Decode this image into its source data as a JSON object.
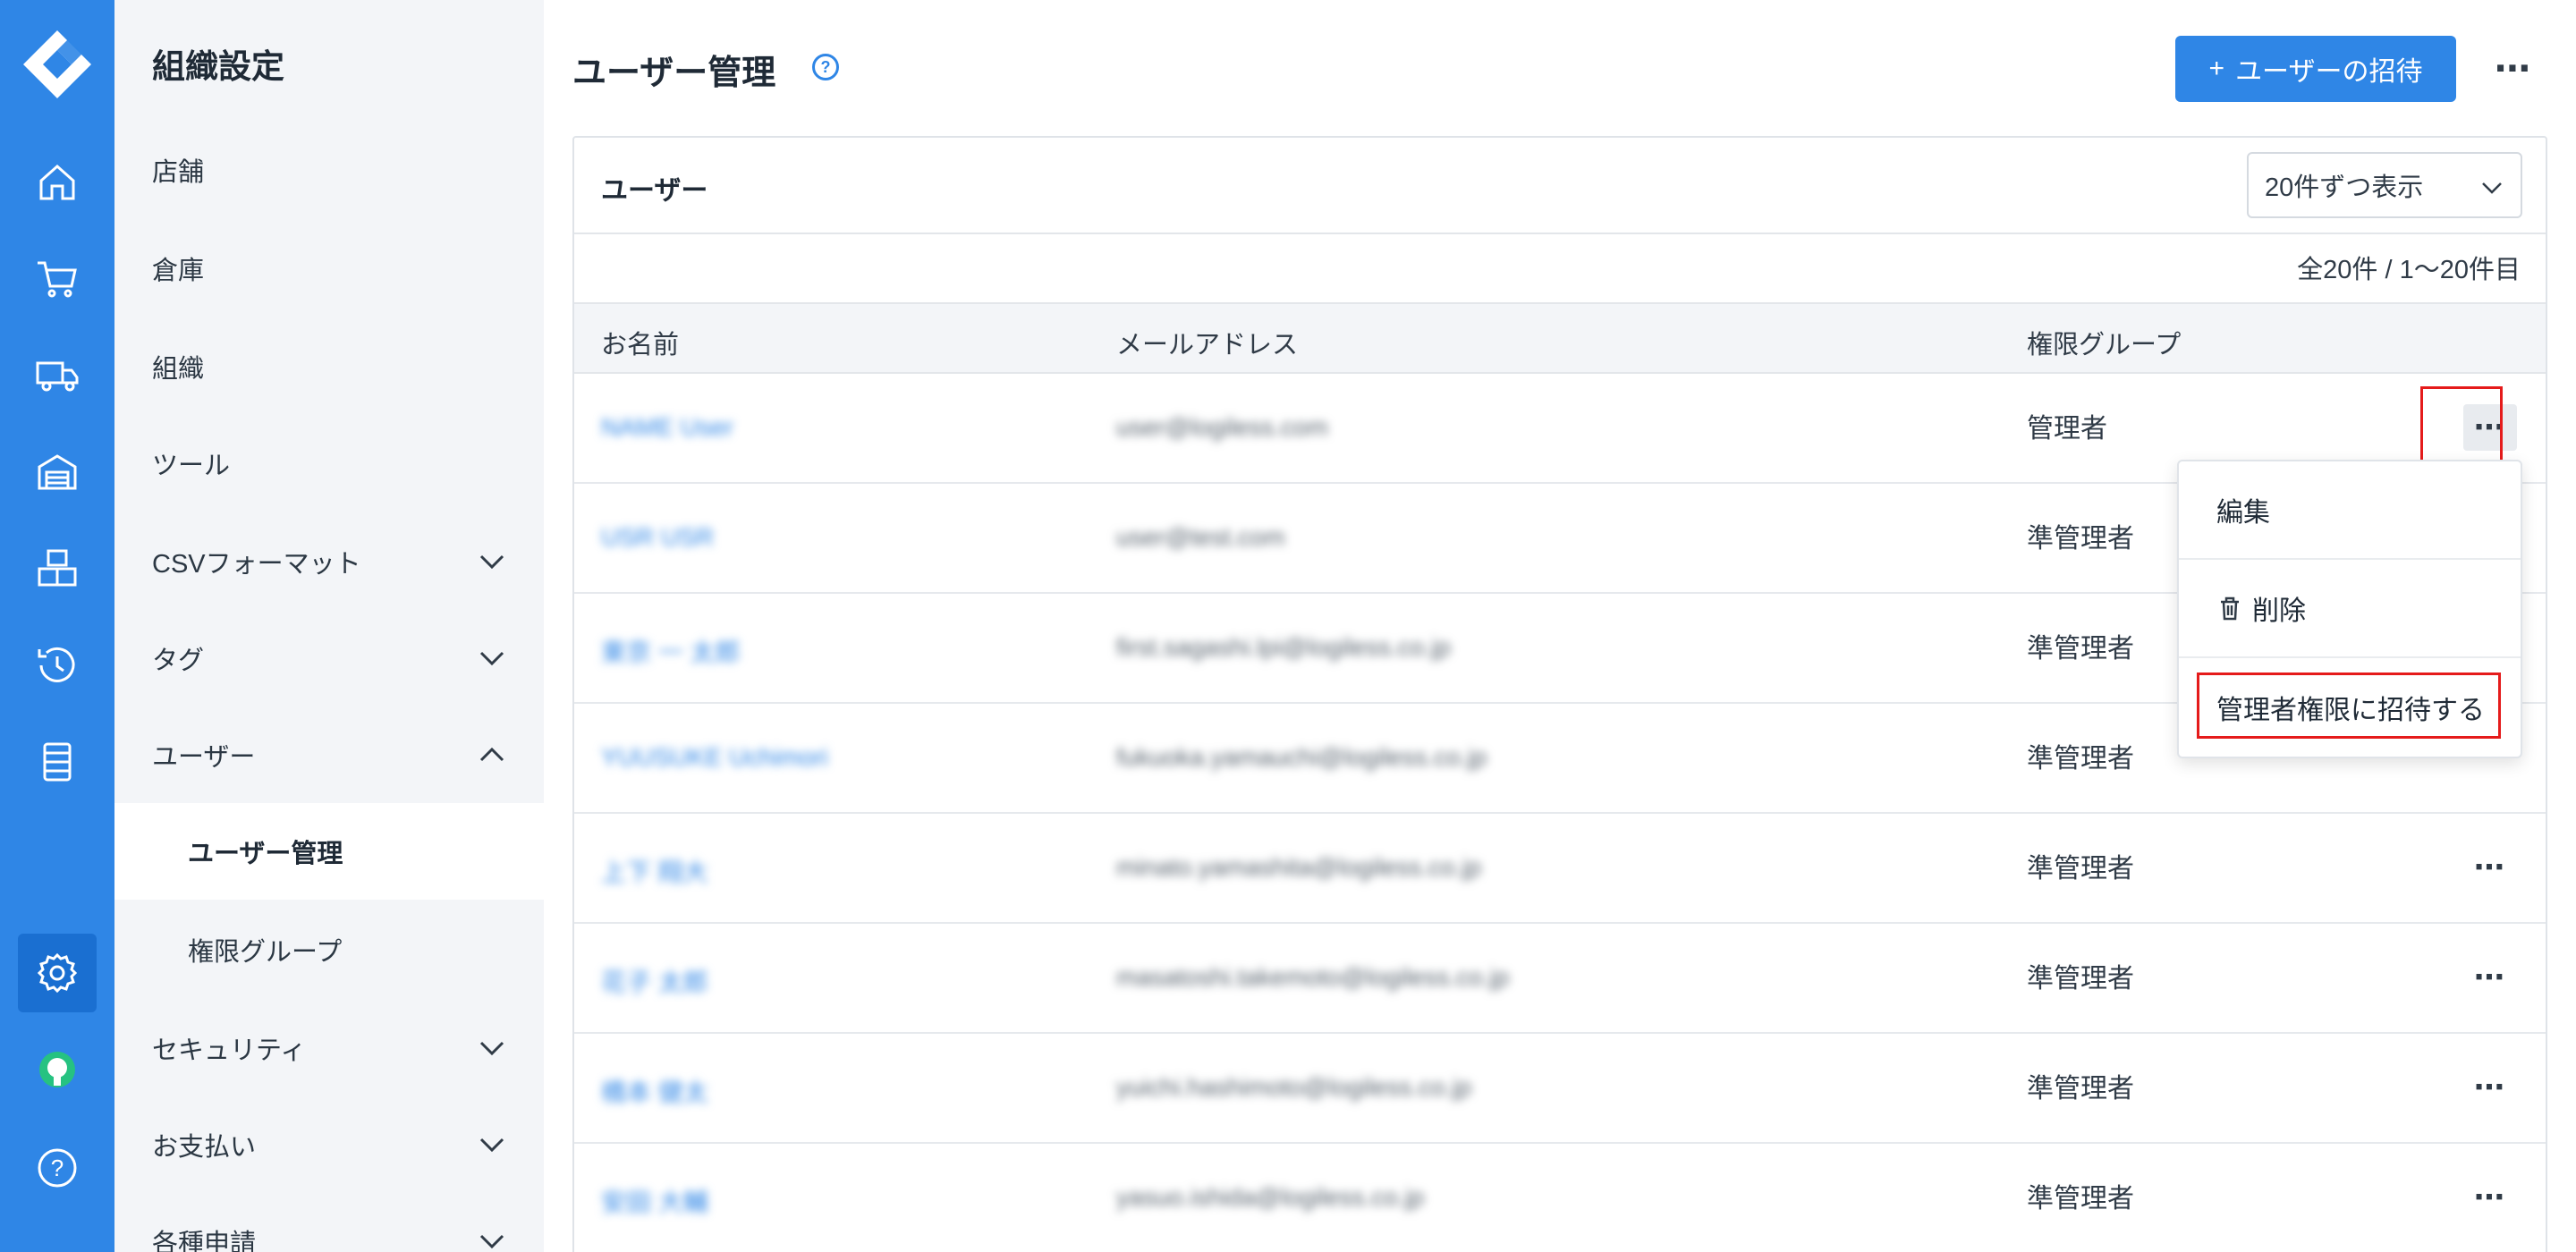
{
  "rail": {
    "icons": [
      "home-icon",
      "cart-icon",
      "truck-icon",
      "warehouse-icon",
      "boxes-icon",
      "history-icon",
      "list-icon",
      "gear-icon",
      "bulb-icon",
      "help-icon"
    ],
    "help_glyph": "?"
  },
  "sidebar": {
    "title": "組織設定",
    "items": [
      {
        "label": "店舗"
      },
      {
        "label": "倉庫"
      },
      {
        "label": "組織"
      },
      {
        "label": "ツール"
      },
      {
        "label": "CSVフォーマット"
      },
      {
        "label": "タグ"
      },
      {
        "label": "ユーザー"
      },
      {
        "label": "ユーザー管理"
      },
      {
        "label": "権限グループ"
      },
      {
        "label": "セキュリティ"
      },
      {
        "label": "お支払い"
      },
      {
        "label": "各種申請"
      }
    ]
  },
  "header": {
    "title": "ユーザー管理",
    "help_glyph": "?",
    "invite_plus": "+",
    "invite_label": "ユーザーの招待",
    "more_glyph": "⋯"
  },
  "card": {
    "title": "ユーザー",
    "per_page": "20件ずつ表示",
    "count": "全20件 / 1〜20件目"
  },
  "table": {
    "columns": [
      "お名前",
      "メールアドレス",
      "権限グループ"
    ],
    "more_glyph": "⋯",
    "rows": [
      {
        "name": "NAME User",
        "email": "user@logiless.com",
        "role": "管理者"
      },
      {
        "name": "USR USR",
        "email": "user@test.com",
        "role": "準管理者"
      },
      {
        "name": "東京 一 太郎",
        "email": "first.sagashi.lpi@logiless.co.jp",
        "role": "準管理者"
      },
      {
        "name": "YUUSUKE Uchimori",
        "email": "fukuoka.yamauchi@logiless.co.jp",
        "role": "準管理者"
      },
      {
        "name": "上下 翔大",
        "email": "minato.yamashita@logiless.co.jp",
        "role": "準管理者"
      },
      {
        "name": "花子 太郎",
        "email": "masatoshi.takemoto@logiless.co.jp",
        "role": "準管理者"
      },
      {
        "name": "橋本 健太",
        "email": "yuichi.hashimoto@logiless.co.jp",
        "role": "準管理者"
      },
      {
        "name": "安田 大輔",
        "email": "yasuo.ishida@logiless.co.jp",
        "role": "準管理者"
      }
    ]
  },
  "menu": {
    "edit": "編集",
    "delete": "削除",
    "invite_admin": "管理者権限に招待する"
  },
  "colors": {
    "rail": "#2f86e6",
    "accent": "#2f86e6",
    "highlight": "#e51b1b"
  }
}
